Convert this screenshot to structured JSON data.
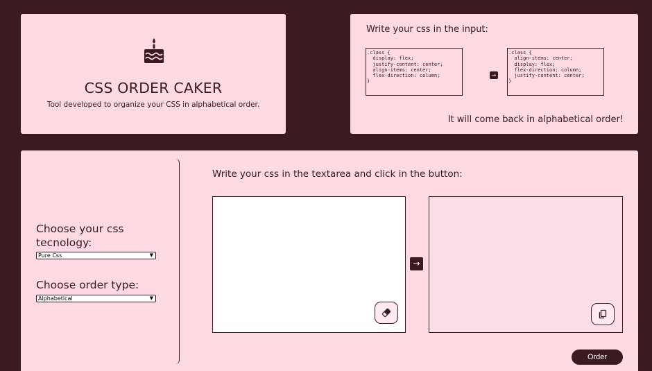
{
  "hero": {
    "icon": "cake-icon",
    "title": "CSS ORDER CAKER",
    "subtitle": "Tool developed to organize your CSS in alphabetical order."
  },
  "example": {
    "title": "Write your css in the input:",
    "code_before": ".class {\n  display: flex;\n  justify-content: center;\n  align-items: center;\n  flex-direction: column;\n}",
    "code_after": ".class {\n  align-items: center;\n  display: flex;\n  flex-direction: column;\n  justify-content: center;\n}",
    "arrow": "→",
    "footer": "It will come back in alphabetical order!"
  },
  "sidebar": {
    "tech_label": "Choose your css tecnology:",
    "tech_selected": "Pure Css",
    "order_label": "Choose order type:",
    "order_selected": "Alphabetical"
  },
  "main": {
    "title": "Write your css in the textarea and click in the button:",
    "input_value": "",
    "output_value": "",
    "arrow": "→",
    "order_button": "Order",
    "erase_icon": "eraser-icon",
    "copy_icon": "copy-icon"
  },
  "colors": {
    "background": "#3b1a21",
    "panel": "#fdd9e1",
    "accent": "#3b1a21"
  }
}
